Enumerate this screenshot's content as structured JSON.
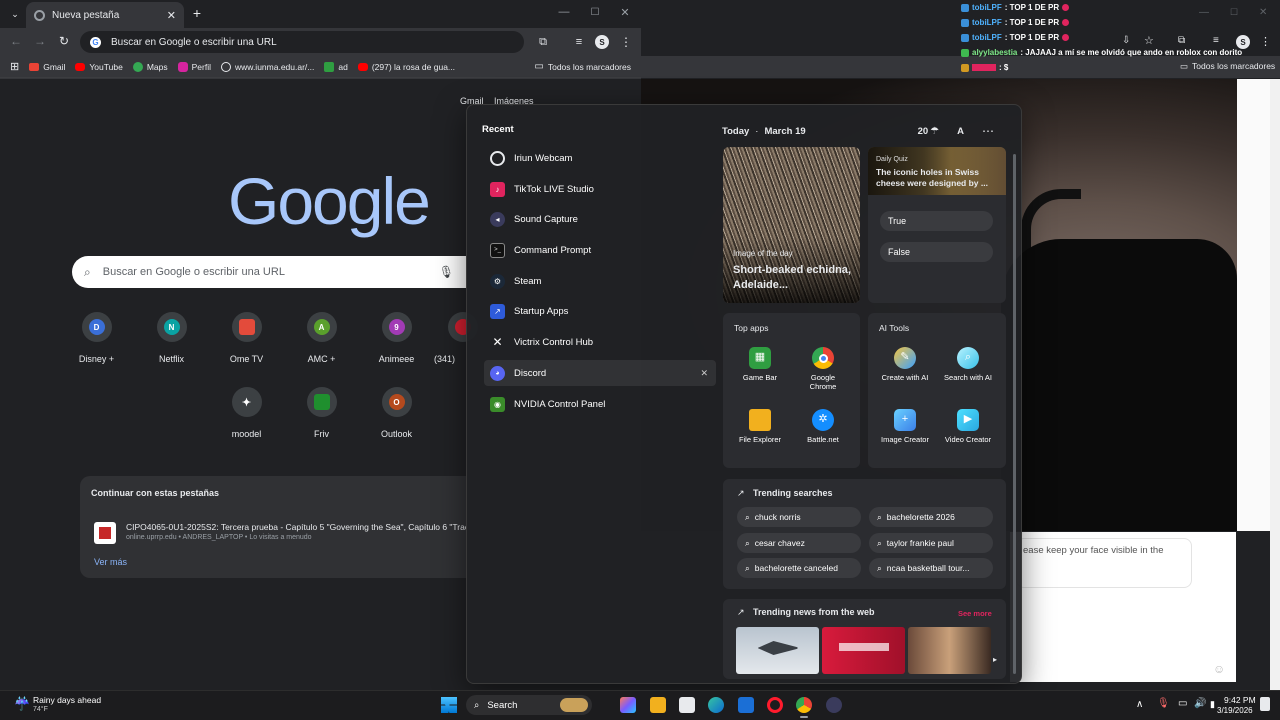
{
  "left_browser": {
    "tab_title": "Nueva pestaña",
    "omnibox_placeholder": "Buscar en Google o escribir una URL",
    "bookmarks": [
      "Gmail",
      "YouTube",
      "Maps",
      "Perfil",
      "www.iunma.edu.ar/...",
      "ad",
      "(297) la rosa de gua..."
    ],
    "all_bookmarks": "Todos los marcadores",
    "top_links": {
      "gmail": "Gmail",
      "images": "Imágenes"
    },
    "logo_text": "Google",
    "search_placeholder": "Buscar en Google o escribir una URL",
    "shortcuts": [
      {
        "label": "Disney +",
        "letter": "D",
        "color": "#3a6fd8"
      },
      {
        "label": "Netflix",
        "letter": "N",
        "color": "#0aa3a3"
      },
      {
        "label": "Ome TV",
        "letter": "",
        "color": "#e34b3b"
      },
      {
        "label": "AMC +",
        "letter": "A",
        "color": "#5aa02c"
      },
      {
        "label": "Animeee",
        "letter": "9",
        "color": "#a23bb5"
      },
      {
        "label": "(341)",
        "letter": "",
        "color": "#d11f2f"
      }
    ],
    "shortcuts_row2": [
      {
        "label": "moodel",
        "letter": "",
        "color": "#3c4043"
      },
      {
        "label": "Friv",
        "letter": "",
        "color": "#1f8f2e"
      },
      {
        "label": "Outlook",
        "letter": "O",
        "color": "#b54a1e"
      }
    ],
    "continue": {
      "title": "Continuar con estas pestañas",
      "item_title": "CIPO4065-0U1-2025S2: Tercera prueba - Capítulo 5 \"Governing the Sea\", Capítulo 6 \"Trac",
      "item_sub": "online.uprrp.edu • ANDRES_LAPTOP • Lo visitas a menudo",
      "more": "Ver más"
    }
  },
  "right_browser": {
    "all_bookmarks": "Todos los marcadores",
    "chat_message": "ease keep your face visible in the",
    "chat_overlay": [
      {
        "name": "tobiLPF",
        "text": ": TOP 1 DE PR"
      },
      {
        "name": "tobiLPF",
        "text": ": TOP 1 DE PR"
      },
      {
        "name": "tobiLPF",
        "text": ": TOP 1 DE PR"
      },
      {
        "name": "alyylabestia",
        "text": ": JAJAAJ a mí se me olvidó que ando en roblox con dorito"
      },
      {
        "name": "",
        "text": ": $"
      }
    ]
  },
  "start_menu": {
    "recent_title": "Recent",
    "apps": [
      {
        "label": "Iriun Webcam",
        "icon": "webcam-icon",
        "color": "#e8eaed"
      },
      {
        "label": "TikTok LIVE Studio",
        "icon": "tiktok-icon",
        "color": "#e0245e"
      },
      {
        "label": "Sound Capture",
        "icon": "sound-capture-icon",
        "color": "#3a3b5c"
      },
      {
        "label": "Command Prompt",
        "icon": "terminal-icon",
        "color": "#2b2b2b"
      },
      {
        "label": "Steam",
        "icon": "steam-icon",
        "color": "#1b2838"
      },
      {
        "label": "Startup Apps",
        "icon": "startup-icon",
        "color": "#2e5bd9"
      },
      {
        "label": "Victrix Control Hub",
        "icon": "victrix-icon",
        "color": "#202124"
      },
      {
        "label": "Discord",
        "icon": "discord-icon",
        "color": "#5865f2"
      },
      {
        "label": "NVIDIA Control Panel",
        "icon": "nvidia-icon",
        "color": "#3a8c2a"
      }
    ],
    "widgets": {
      "date_today": "Today",
      "date": "March 19",
      "weather_temp": "20",
      "account_letter": "A",
      "iotd_label": "Image of the day",
      "iotd_title": "Short-beaked echidna, Adelaide...",
      "quiz_label": "Daily Quiz",
      "quiz_title": "The iconic holes in Swiss cheese were designed by ...",
      "quiz_true": "True",
      "quiz_false": "False",
      "top_apps_title": "Top apps",
      "top_apps": [
        {
          "label": "Game Bar",
          "icon": "game-bar-icon",
          "color": "#2f9e41"
        },
        {
          "label": "Google Chrome",
          "icon": "chrome-icon",
          "color": "#e8453c"
        },
        {
          "label": "File Explorer",
          "icon": "folder-icon",
          "color": "#f2b01e"
        },
        {
          "label": "Battle.net",
          "icon": "battlenet-icon",
          "color": "#148eff"
        }
      ],
      "ai_tools_title": "AI Tools",
      "ai_tools": [
        {
          "label": "Create with AI",
          "icon": "create-ai-icon",
          "color": "#3aa0ff"
        },
        {
          "label": "Search with AI",
          "icon": "search-ai-icon",
          "color": "#38c0e8"
        },
        {
          "label": "Image Creator",
          "icon": "image-creator-icon",
          "color": "#3b7fe8"
        },
        {
          "label": "Video Creator",
          "icon": "video-creator-icon",
          "color": "#2aa7e0"
        }
      ],
      "trending_title": "Trending searches",
      "trending": [
        "chuck norris",
        "bachelorette 2026",
        "cesar chavez",
        "taylor frankie paul",
        "bachelorette canceled",
        "ncaa basketball tour..."
      ],
      "news_title": "Trending news from the web",
      "news_more": "See more"
    }
  },
  "taskbar": {
    "weather_title": "Rainy days ahead",
    "weather_temp": "74°F",
    "search_label": "Search",
    "time": "9:42 PM",
    "date": "3/19/2026"
  }
}
